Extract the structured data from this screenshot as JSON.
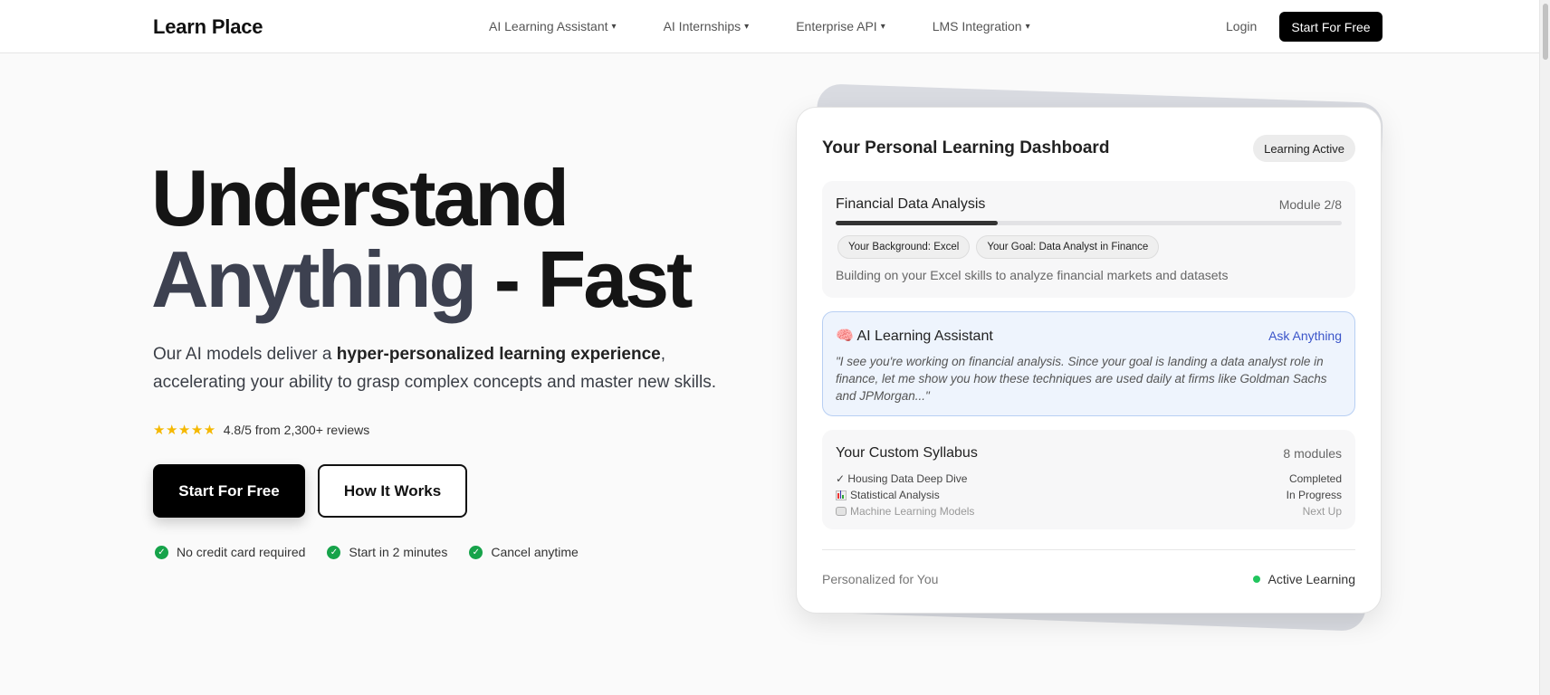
{
  "nav": {
    "brand": "Learn Place",
    "menu": [
      {
        "label": "AI Learning Assistant"
      },
      {
        "label": "AI Internships"
      },
      {
        "label": "Enterprise API"
      },
      {
        "label": "LMS Integration"
      }
    ],
    "caret": "▾",
    "login": "Login",
    "cta": "Start For Free"
  },
  "hero": {
    "line1": "Understand",
    "line2_a": "Anything",
    "line2_b": " - Fast",
    "sub_pre": "Our AI models deliver a ",
    "sub_bold": "hyper-personalized learning experience",
    "sub_post": ", accelerating your ability to grasp complex concepts and master new skills.",
    "stars": "★★★★★",
    "rating": "4.8/5 from 2,300+ reviews",
    "primary_button": "Start For Free",
    "secondary_button": "How It Works",
    "perks": [
      "No credit card required",
      "Start in 2 minutes",
      "Cancel anytime"
    ]
  },
  "dashboard": {
    "title": "Your Personal Learning Dashboard",
    "status": "Learning Active",
    "course": {
      "title": "Financial Data Analysis",
      "module": "Module 2/8",
      "progress_fraction": 0.32,
      "chips": [
        "Your Background: Excel",
        "Your Goal: Data Analyst in Finance"
      ],
      "description": "Building on your Excel skills to analyze financial markets and datasets"
    },
    "assistant": {
      "icon": "🧠",
      "title": "AI Learning Assistant",
      "ask": "Ask Anything",
      "quote": "\"I see you're working on financial analysis. Since your goal is landing a data analyst role in finance, let me show you how these techniques are used daily at firms like Goldman Sachs and JPMorgan...\""
    },
    "syllabus": {
      "title": "Your Custom Syllabus",
      "count": "8 modules",
      "items": [
        {
          "name": "✓ Housing Data Deep Dive",
          "status": "Completed"
        },
        {
          "name": "Statistical Analysis",
          "status": "In Progress"
        },
        {
          "name": "Machine Learning Models",
          "status": "Next Up"
        }
      ]
    },
    "footer_left": "Personalized for You",
    "footer_right": "Active Learning"
  },
  "colors": {
    "accent_link": "#3b55c9",
    "success": "#16a34a",
    "star": "#f5b800"
  }
}
